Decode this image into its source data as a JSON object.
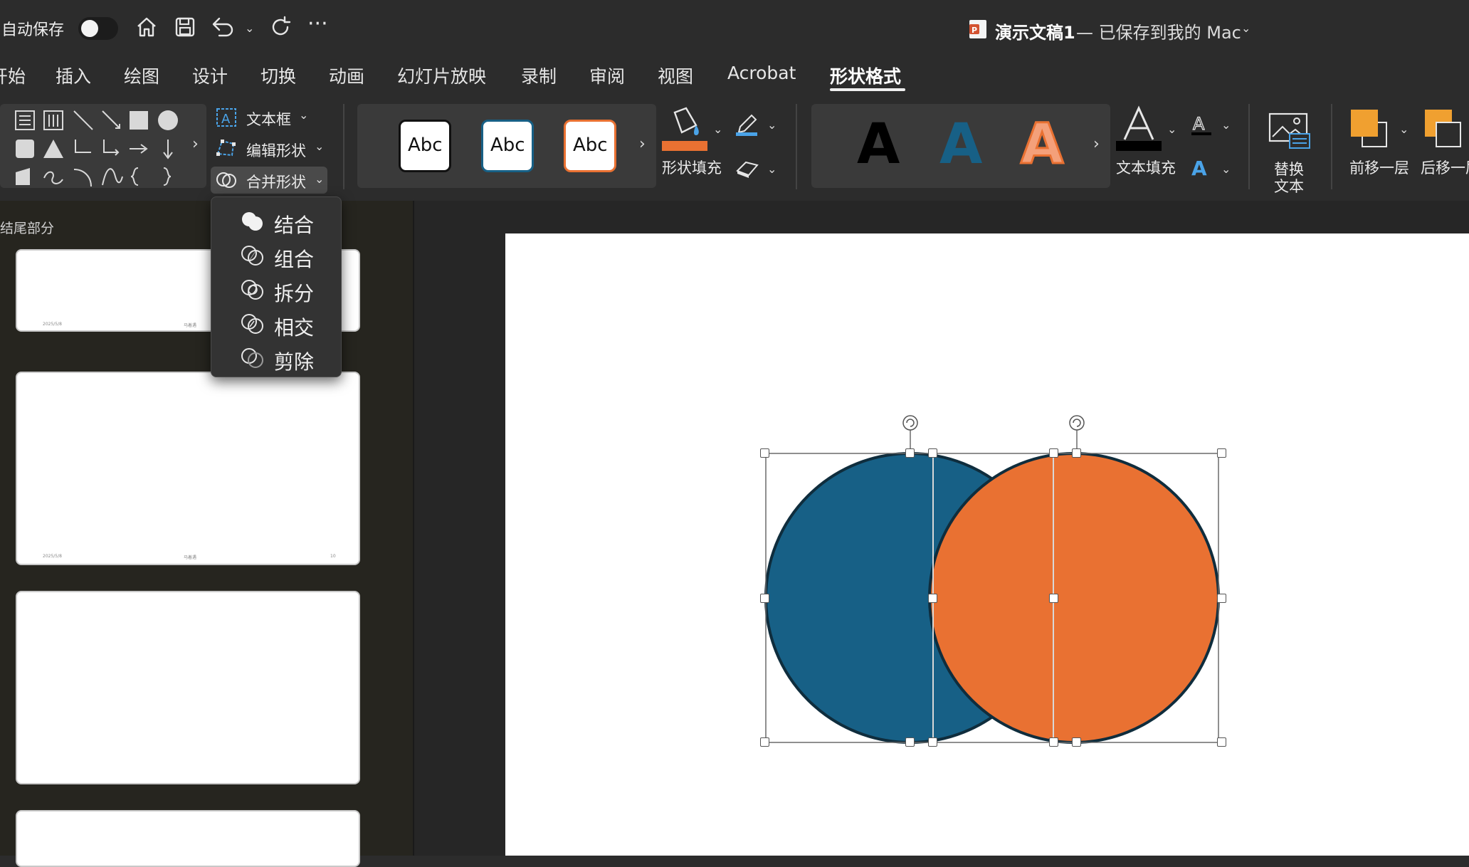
{
  "titlebar": {
    "autosave_label": "自动保存",
    "doc_title": "演示文稿1",
    "doc_status": "— 已保存到我的 Mac"
  },
  "tabs": [
    {
      "label": "开始"
    },
    {
      "label": "插入"
    },
    {
      "label": "绘图"
    },
    {
      "label": "设计"
    },
    {
      "label": "切换"
    },
    {
      "label": "动画"
    },
    {
      "label": "幻灯片放映"
    },
    {
      "label": "录制"
    },
    {
      "label": "审阅"
    },
    {
      "label": "视图"
    },
    {
      "label": "Acrobat"
    },
    {
      "label": "形状格式",
      "active": true
    }
  ],
  "ribbon": {
    "textbox_label": "文本框",
    "edit_shape_label": "编辑形状",
    "merge_shapes_label": "合并形状",
    "style_samples": [
      "Abc",
      "Abc",
      "Abc"
    ],
    "shape_fill_label": "形状填充",
    "wordart_samples": [
      "A",
      "A",
      "A"
    ],
    "text_fill_label": "文本填充",
    "alt_text_label_1": "替换",
    "alt_text_label_2": "文本",
    "bring_forward_label": "前移一层",
    "send_backward_label": "后移一层"
  },
  "merge_menu": {
    "items": [
      {
        "label": "结合"
      },
      {
        "label": "组合"
      },
      {
        "label": "拆分"
      },
      {
        "label": "相交"
      },
      {
        "label": "剪除"
      }
    ]
  },
  "sidebar": {
    "section_label": "结尾部分",
    "thumb_footer_date": "2025/5/8",
    "thumb_footer_center": "马着遇",
    "thumb_footer_page": "10"
  },
  "colors": {
    "accent_blue": "#176086",
    "accent_orange": "#E97132",
    "ribbon_bg": "#2c2c2c"
  }
}
